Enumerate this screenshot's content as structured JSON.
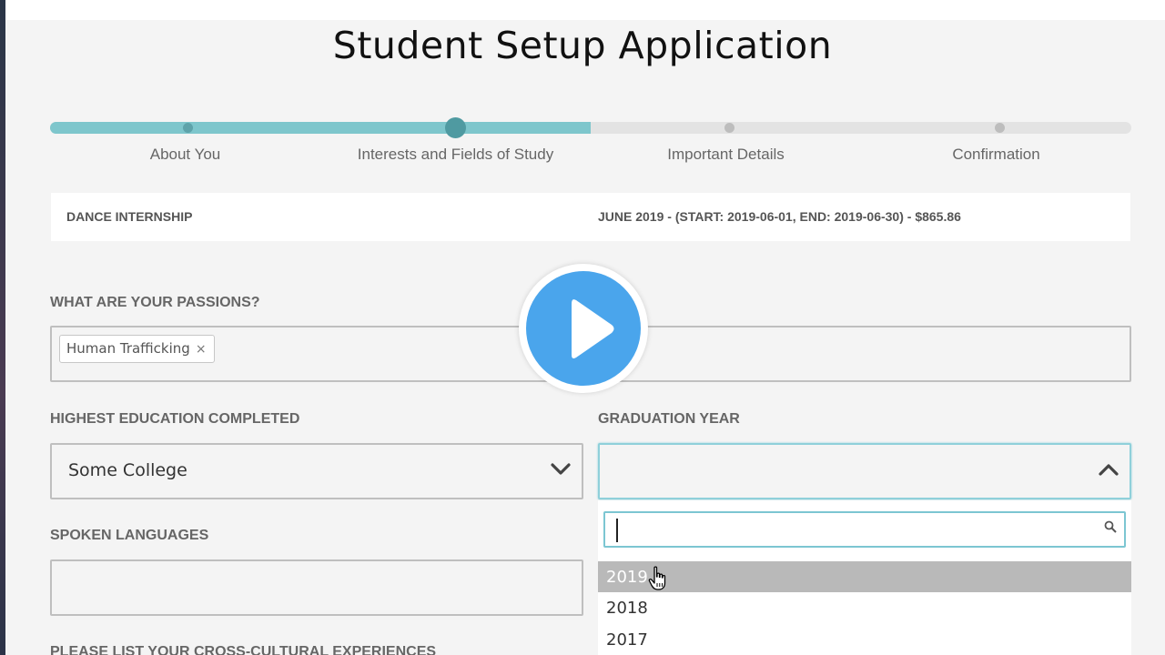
{
  "title": "Student Setup Application",
  "progress": {
    "fraction_complete": 0.5,
    "steps": [
      {
        "label": "About You",
        "state": "done"
      },
      {
        "label": "Interests and Fields of Study",
        "state": "current"
      },
      {
        "label": "Important Details",
        "state": "upcoming"
      },
      {
        "label": "Confirmation",
        "state": "upcoming"
      }
    ]
  },
  "summary": {
    "program": "DANCE INTERNSHIP",
    "session": "JUNE 2019 - (START: 2019-06-01, END: 2019-06-30) - $865.86"
  },
  "passions": {
    "label": "WHAT ARE YOUR PASSIONS?",
    "tags": [
      {
        "text": "Human Trafficking",
        "remove": "×"
      }
    ]
  },
  "education": {
    "label": "HIGHEST EDUCATION COMPLETED",
    "value": "Some College"
  },
  "graduation": {
    "label": "GRADUATION YEAR",
    "value": "",
    "options": [
      "2019",
      "2018",
      "2017"
    ],
    "highlighted": "2019"
  },
  "languages": {
    "label": "SPOKEN LANGUAGES",
    "value": ""
  },
  "cross_cultural": {
    "label": "PLEASE LIST YOUR CROSS-CULTURAL EXPERIENCES"
  },
  "colors": {
    "accent": "#7ec6cc",
    "play_button": "#4aa5ec",
    "focus_border": "#7cc6d2"
  },
  "icons": {
    "play": "play-icon",
    "select_chevron": "chevron-down-icon",
    "dropdown_chevron": "chevron-up-icon",
    "search": "search-icon",
    "tag_remove": "close-icon",
    "cursor": "hand-pointer-icon"
  }
}
